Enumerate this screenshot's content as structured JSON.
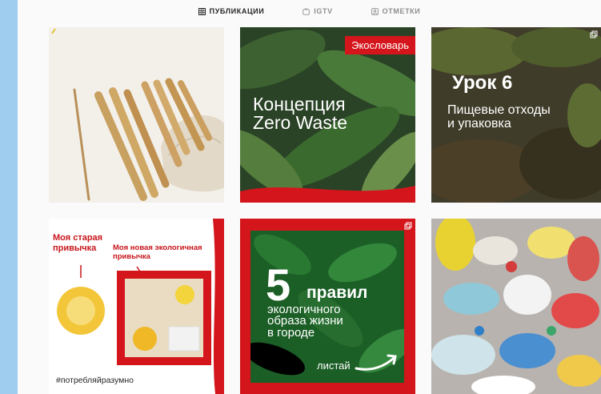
{
  "tabs": [
    {
      "label": "ПУБЛИКАЦИИ",
      "icon": "grid-icon",
      "active": true
    },
    {
      "label": "IGTV",
      "icon": "igtv-icon",
      "active": false
    },
    {
      "label": "ОТМЕТКИ",
      "icon": "tag-icon",
      "active": false
    }
  ],
  "posts": {
    "p2": {
      "badge": "Экословарь",
      "line1": "Концепция",
      "line2": "Zero Waste"
    },
    "p3": {
      "title": "Урок 6",
      "line1": "Пищевые отходы",
      "line2": "и упаковка"
    },
    "p4": {
      "old": "Моя старая привычка",
      "new": "Моя новая экологичная привычка",
      "hashtag": "#потребляйразумно"
    },
    "p5": {
      "number": "5",
      "word": "правил",
      "line1": "экологичного",
      "line2": "образа жизни",
      "line3": "в городе",
      "swipe": "листай"
    }
  },
  "colors": {
    "accent_red": "#d4161c",
    "leaf_green": "#1d6a2b",
    "page_bg": "#fafafa",
    "outer_bg": "#9fcdf0"
  }
}
